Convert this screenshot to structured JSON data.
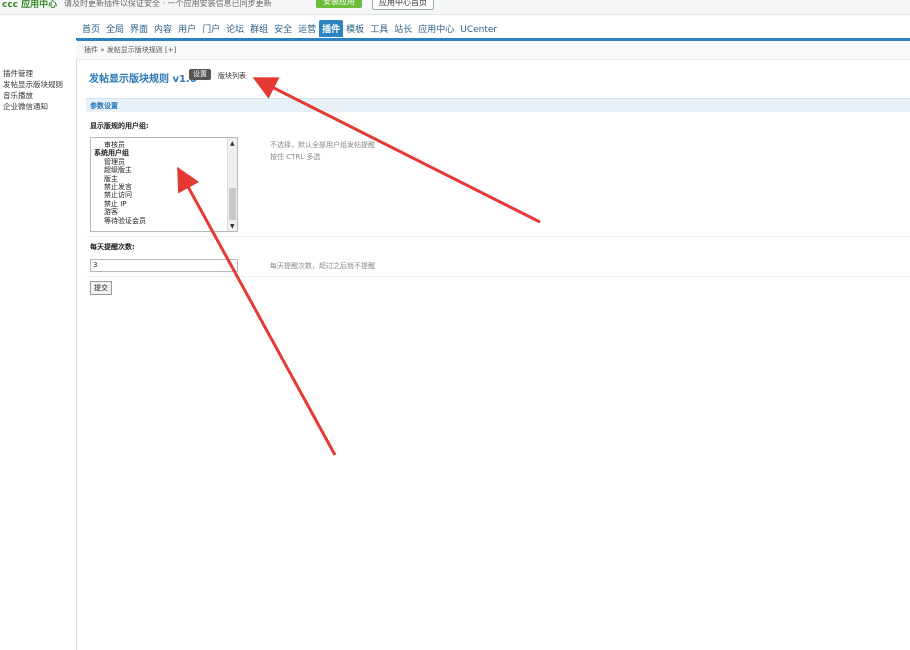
{
  "topbar": {
    "logo": "ccc 应用中心",
    "message": "请及时更新插件以保证安全 · 一个应用安装信息已同步更新",
    "primary_button": "安装应用",
    "secondary_button": "应用中心首页"
  },
  "nav": {
    "items": [
      "首页",
      "全局",
      "界面",
      "内容",
      "用户",
      "门户",
      "论坛",
      "群组",
      "安全",
      "运营",
      "插件",
      "模板",
      "工具",
      "站长",
      "应用中心",
      "UCenter"
    ],
    "active_index": 10
  },
  "sidebar": {
    "items": [
      "插件管理",
      "发帖显示版块规则",
      "音乐播放",
      "企业微信通知"
    ]
  },
  "breadcrumb": "插件 » 发帖显示版块规则 [+]",
  "page": {
    "title": "发帖显示版块规则 v1.0",
    "settings_tag": "设置",
    "blocks_link": "版块列表"
  },
  "section": {
    "title": "参数设置"
  },
  "form": {
    "user_groups_label": "显示版规的用户组:",
    "user_groups_options": [
      {
        "text": "审核员",
        "group": false
      },
      {
        "text": "系统用户组",
        "group": true
      },
      {
        "text": "管理员",
        "group": false
      },
      {
        "text": "超级版主",
        "group": false
      },
      {
        "text": "版主",
        "group": false
      },
      {
        "text": "禁止发言",
        "group": false
      },
      {
        "text": "禁止访问",
        "group": false
      },
      {
        "text": "禁止 IP",
        "group": false
      },
      {
        "text": "游客",
        "group": false
      },
      {
        "text": "等待验证会员",
        "group": false
      }
    ],
    "user_groups_hint_line1": "不选择，默认全部用户组发帖提醒",
    "user_groups_hint_line2": "按住 CTRL 多选",
    "daily_label": "每天提醒次数:",
    "daily_value": "3",
    "daily_hint": "每天提醒次数，超过之后就不提醒",
    "submit": "提交"
  },
  "colors": {
    "accent": "#2b82c1",
    "annotation_arrow": "#e53935"
  }
}
